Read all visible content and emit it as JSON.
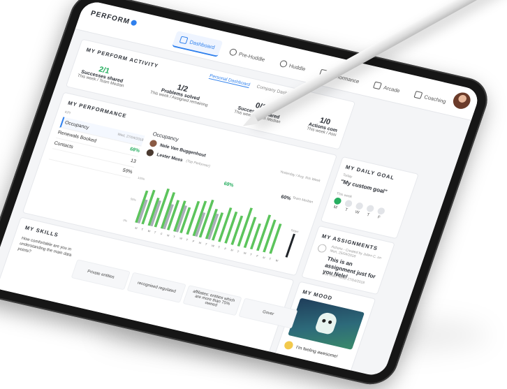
{
  "app": {
    "logo_text": "PERFORM"
  },
  "nav": [
    {
      "label": "Dashboard",
      "icon": "dashboard-icon",
      "active": true
    },
    {
      "label": "Pre-Huddle",
      "icon": "huddle-icon"
    },
    {
      "label": "Huddle",
      "icon": "people-icon"
    },
    {
      "label": "Performance",
      "icon": "bar-chart-icon"
    },
    {
      "label": "Arcade",
      "icon": "gamepad-icon"
    },
    {
      "label": "Coaching",
      "icon": "puzzle-icon"
    }
  ],
  "activity": {
    "title": "MY PERFORM ACTIVITY",
    "tabs": [
      "Personal Dashboard",
      "Company Dashboard"
    ],
    "stats": [
      {
        "value": "2/1",
        "label": "Successes shared",
        "sub": "This week / Team Median"
      },
      {
        "value": "1/2",
        "label": "Problems solved",
        "sub": "This week / Assigned remaining"
      },
      {
        "value": "0/1",
        "label": "Successes shared",
        "sub": "This week / Team Median"
      },
      {
        "value": "1/0",
        "label": "Actions com",
        "sub": "This week / Assi"
      }
    ]
  },
  "performance": {
    "title": "MY PERFORMANCE",
    "kpi_header": "KPI",
    "date": "Wed, 27/04/2018",
    "kpis": [
      {
        "name": "Occupancy",
        "value": "68%"
      },
      {
        "name": "Renewals Booked",
        "value": "13"
      },
      {
        "name": "Contacts",
        "value": "59%"
      }
    ],
    "occupancy": {
      "title": "Occupancy",
      "legend": "Yesterday / Avg. this Week",
      "team_median": "Team Median",
      "people": [
        {
          "name": "Nele Van Buggenhout",
          "tag": "",
          "v1": "68%",
          "v2": "60%"
        },
        {
          "name": "Lester Moss",
          "tag": "(Top Performer)",
          "v1": "67%",
          "v2": "60%"
        }
      ]
    }
  },
  "chart_data": {
    "type": "bar",
    "categories": [
      "M",
      "T",
      "W",
      "T",
      "F",
      "M",
      "T",
      "W",
      "T",
      "F",
      "M",
      "T",
      "W",
      "T",
      "F",
      "M",
      "T",
      "W",
      "T",
      "F",
      "M",
      "T",
      "W"
    ],
    "series": [
      {
        "values": [
          75,
          80,
          65,
          90,
          85,
          70,
          72,
          60,
          78,
          82,
          88,
          70,
          65,
          80,
          74,
          68,
          90,
          72,
          60,
          84,
          76,
          70,
          0
        ]
      },
      {
        "values": [
          55,
          0,
          60,
          0,
          58,
          0,
          62,
          0,
          0,
          56,
          0,
          60,
          0,
          0,
          0,
          0,
          0,
          0,
          0,
          0,
          0,
          0,
          0
        ]
      }
    ],
    "ylim": [
      0,
      100
    ],
    "yticks": [
      "100%",
      "50%",
      "0%"
    ],
    "target_label": "Target",
    "target_value": 55,
    "colors": {
      "series_1": "#5cc45c",
      "series_2": "#a9aeb8",
      "target": "#1f2328"
    }
  },
  "daily_goal": {
    "title": "MY DAILY GOAL",
    "sub": "Today",
    "text": "\"My custom goal\"",
    "week_label": "This week",
    "days": [
      {
        "letter": "M",
        "done": true
      },
      {
        "letter": "T",
        "done": false
      },
      {
        "letter": "W",
        "done": false
      },
      {
        "letter": "T",
        "done": false
      },
      {
        "letter": "F",
        "done": false
      }
    ]
  },
  "assignments": {
    "title": "MY ASSIGNMENTS",
    "meta": "Actions - Created by Julien C. on Mon, 25/04/2018",
    "text": "This is an assignment just for you Nele!",
    "due": "Due Date: Wed, 27/04/2018"
  },
  "mood": {
    "title": "MY MOOD",
    "text": "I'm feeling awesome!"
  },
  "skills": {
    "title": "MY SKILLS",
    "question": "How comfortable are you in understanding the main data points?",
    "columns": [
      "Private entities",
      "recognised regulated",
      "affiliates: entities which are more than 75% owned",
      "Gover"
    ]
  }
}
